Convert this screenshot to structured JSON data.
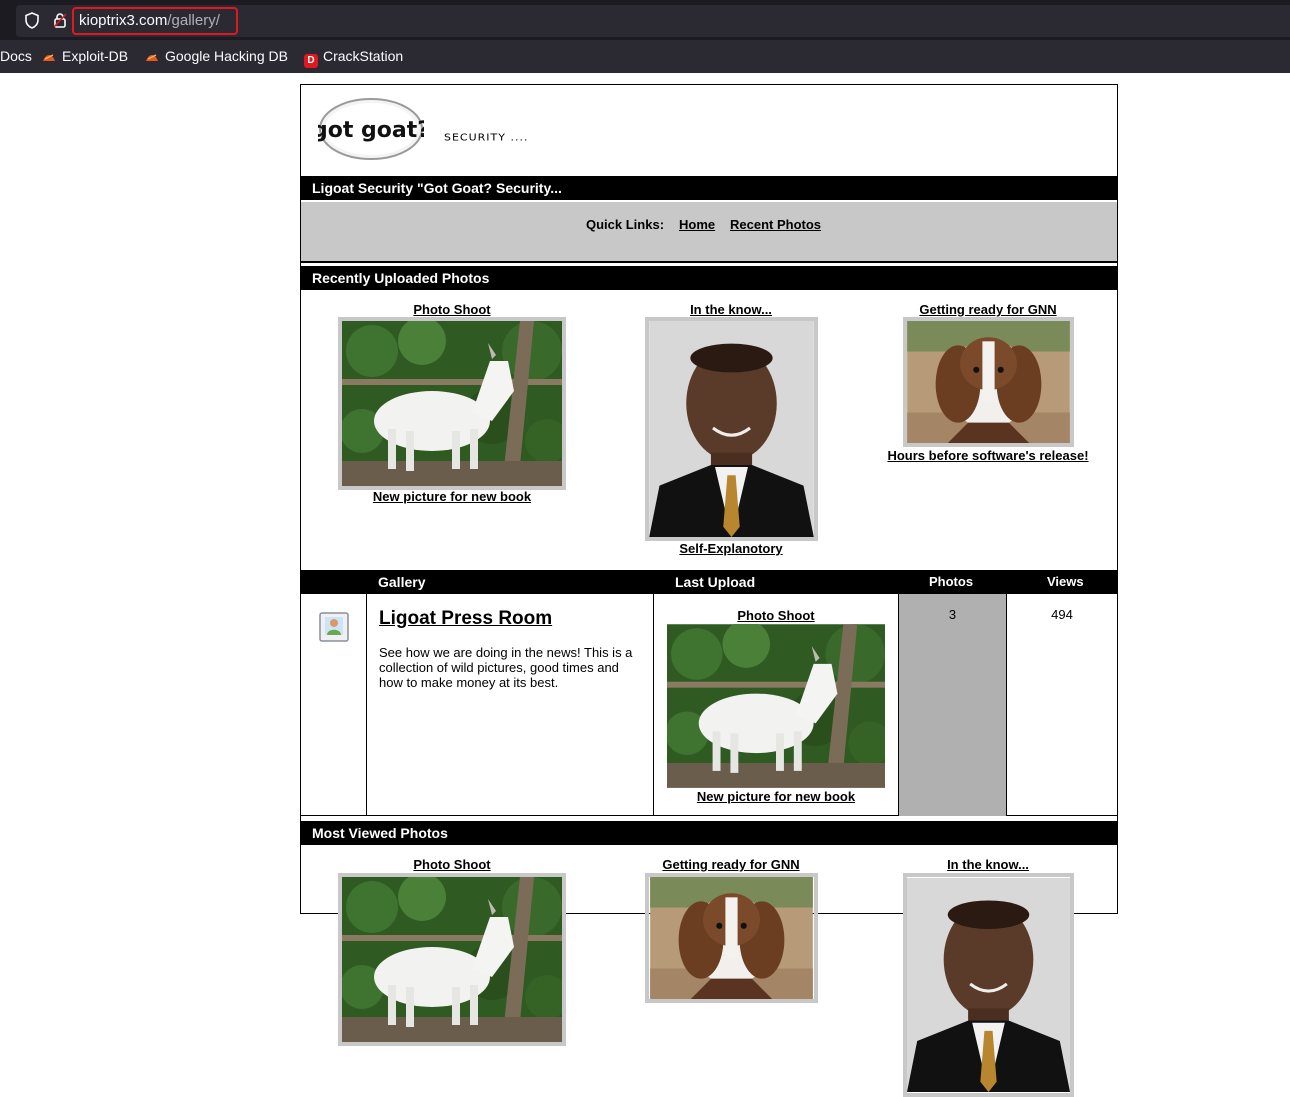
{
  "browser": {
    "url_host": "kioptrix3.com",
    "url_path": "/gallery/",
    "bookmarks": [
      "Docs",
      "Exploit-DB",
      "Google Hacking DB",
      "CrackStation"
    ],
    "bookmark_crack_icon_letter": "D"
  },
  "header": {
    "logo_text": "got goat?",
    "tagline": "SECURITY ....",
    "title": "Ligoat Security \"Got Goat? Security..."
  },
  "quick_links": {
    "label": "Quick Links:",
    "home": "Home",
    "recent": "Recent Photos"
  },
  "recent": {
    "heading": "Recently Uploaded Photos",
    "items": [
      {
        "title": "Photo Shoot",
        "caption": "New picture for new book",
        "image": "white-goat"
      },
      {
        "title": "In the know...",
        "caption": "Self-Explanotory",
        "image": "man-portrait"
      },
      {
        "title": "Getting ready for GNN",
        "caption": "Hours before software's release!",
        "image": "brown-goat"
      }
    ]
  },
  "gallery": {
    "headers": {
      "gallery": "Gallery",
      "last_upload": "Last Upload",
      "photos": "Photos",
      "views": "Views"
    },
    "albums": [
      {
        "name": "Ligoat Press Room",
        "description": "See how we are doing in the news! This is a collection of wild pictures, good times and how to make money at its best.",
        "last_upload_title": "Photo Shoot",
        "last_upload_caption": "New picture for new book",
        "photos": "3",
        "views": "494"
      }
    ]
  },
  "most_viewed": {
    "heading": "Most Viewed Photos",
    "items": [
      {
        "title": "Photo Shoot",
        "image": "white-goat"
      },
      {
        "title": "Getting ready for GNN",
        "image": "brown-goat"
      },
      {
        "title": "In the know...",
        "image": "man-portrait"
      }
    ]
  },
  "colors": {
    "bar": "#000000",
    "quick_bg": "#c8c8c8",
    "photos_bg": "#b0b0b0",
    "url_highlight": "#e0181f"
  }
}
